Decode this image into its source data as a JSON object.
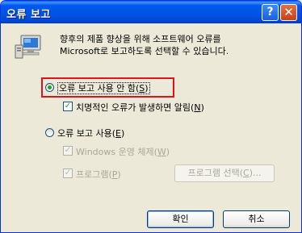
{
  "window": {
    "title": "오류 보고"
  },
  "titlebar": {
    "help": "?",
    "close": "✕"
  },
  "message": "향후의 제품 향상을 위해 소프트웨어 오류를\nMicrosoft로 보고하도록 선택할 수 있습니다.",
  "options": {
    "disable": {
      "label": "오류 보고 사용 안 함(",
      "key": "S",
      "end": ")"
    },
    "notify": {
      "label": "치명적인 오류가 발생하면 알림(",
      "key": "N",
      "end": ")"
    },
    "enable": {
      "label": "오류 보고 사용(",
      "key": "E",
      "end": ")"
    },
    "windows": {
      "label": "Windows 운영 체제(",
      "key": "W",
      "end": ")"
    },
    "programs": {
      "label": "프로그램(",
      "key": "P",
      "end": ")"
    },
    "choose_programs": {
      "label": "프로그램 선택(",
      "key": "C",
      "end": ")..."
    }
  },
  "buttons": {
    "ok": "확인",
    "cancel": "취소"
  }
}
